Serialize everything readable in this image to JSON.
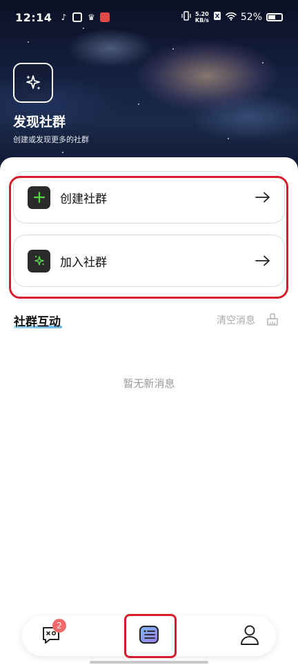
{
  "status_bar": {
    "time": "12:14",
    "net_speed_value": "5.20",
    "net_speed_unit": "KB/s",
    "battery": "52%"
  },
  "hero": {
    "title": "发现社群",
    "subtitle": "创建或发现更多的社群",
    "icon": "sparkles-icon"
  },
  "actions": {
    "create_label": "创建社群",
    "join_label": "加入社群"
  },
  "interaction": {
    "title": "社群互动",
    "clear_label": "清空消息",
    "empty_text": "暂无新消息"
  },
  "bottom_nav": {
    "messages_badge": "2",
    "items": [
      "messages-icon",
      "community-list-icon",
      "profile-icon"
    ]
  },
  "colors": {
    "highlight": "#d91c2c",
    "plus_green": "#5bd24a",
    "badge": "#f06a6a"
  }
}
